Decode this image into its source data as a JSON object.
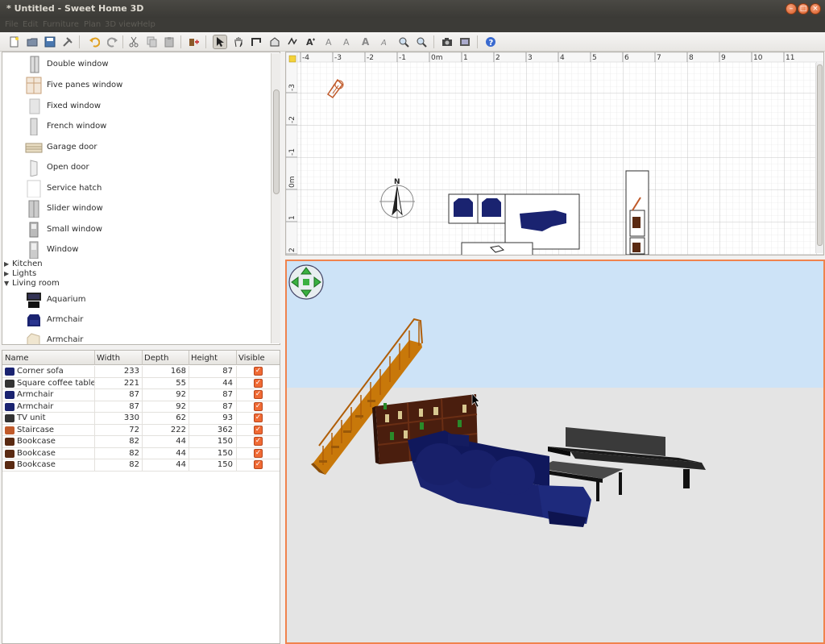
{
  "window": {
    "title": "* Untitled - Sweet Home 3D",
    "minimize": "–",
    "maximize": "□",
    "close": "×"
  },
  "menu": {
    "items": [
      "File",
      "Edit",
      "Furniture",
      "Plan",
      "3D view",
      "Help"
    ]
  },
  "toolbar": {
    "icons": [
      "new-icon",
      "open-icon",
      "save-icon",
      "cut-icon",
      "undo-icon",
      "redo-icon",
      "cut-icon",
      "copy-icon",
      "paste-icon",
      "add-furniture-icon",
      "select-icon",
      "pan-icon",
      "create-walls-icon",
      "create-rooms-icon",
      "create-dimensions-icon",
      "add-text-icon",
      "zoom-in-icon",
      "zoom-out-icon",
      "photo-icon",
      "video-icon",
      "help-icon"
    ]
  },
  "catalog": {
    "items_top": [
      {
        "label": "Double window",
        "icon": "double-window-icon"
      },
      {
        "label": "Five panes window",
        "icon": "five-panes-window-icon"
      },
      {
        "label": "Fixed window",
        "icon": "fixed-window-icon"
      },
      {
        "label": "French window",
        "icon": "french-window-icon"
      },
      {
        "label": "Garage door",
        "icon": "garage-door-icon"
      },
      {
        "label": "Open door",
        "icon": "open-door-icon"
      },
      {
        "label": "Service hatch",
        "icon": "service-hatch-icon"
      },
      {
        "label": "Slider window",
        "icon": "slider-window-icon"
      },
      {
        "label": "Small window",
        "icon": "small-window-icon"
      },
      {
        "label": "Window",
        "icon": "window-icon"
      }
    ],
    "groups": [
      {
        "label": "Kitchen",
        "expanded": false
      },
      {
        "label": "Lights",
        "expanded": false
      },
      {
        "label": "Living room",
        "expanded": true
      }
    ],
    "items_living": [
      {
        "label": "Aquarium",
        "icon": "aquarium-icon"
      },
      {
        "label": "Armchair",
        "icon": "armchair-icon"
      },
      {
        "label": "Armchair",
        "icon": "armchair-icon"
      }
    ]
  },
  "furniture": {
    "columns": [
      "Name",
      "Width",
      "Depth",
      "Height",
      "Visible"
    ],
    "rows": [
      {
        "name": "Corner sofa",
        "width": "233",
        "depth": "168",
        "height": "87",
        "visible": true
      },
      {
        "name": "Square coffee table",
        "width": "221",
        "depth": "55",
        "height": "44",
        "visible": true
      },
      {
        "name": "Armchair",
        "width": "87",
        "depth": "92",
        "height": "87",
        "visible": true
      },
      {
        "name": "Armchair",
        "width": "87",
        "depth": "92",
        "height": "87",
        "visible": true
      },
      {
        "name": "TV unit",
        "width": "330",
        "depth": "62",
        "height": "93",
        "visible": true
      },
      {
        "name": "Staircase",
        "width": "72",
        "depth": "222",
        "height": "362",
        "visible": true
      },
      {
        "name": "Bookcase",
        "width": "82",
        "depth": "44",
        "height": "150",
        "visible": true
      },
      {
        "name": "Bookcase",
        "width": "82",
        "depth": "44",
        "height": "150",
        "visible": true
      },
      {
        "name": "Bookcase",
        "width": "82",
        "depth": "44",
        "height": "150",
        "visible": true
      }
    ]
  },
  "plan": {
    "ruler_x": [
      "-4",
      "-3",
      "-2",
      "-1",
      "0m",
      "1",
      "2",
      "3",
      "4",
      "5",
      "6",
      "7",
      "8",
      "9",
      "10",
      "11"
    ],
    "ruler_y": [
      "-3",
      "-2",
      "-1",
      "0m",
      "1",
      "2"
    ],
    "compass_label": "N"
  },
  "colors": {
    "accent": "#f0834d",
    "sky": "#cde3f7",
    "floor": "#e4e4e4",
    "sofa": "#1a2370",
    "wood": "#c8780a"
  }
}
